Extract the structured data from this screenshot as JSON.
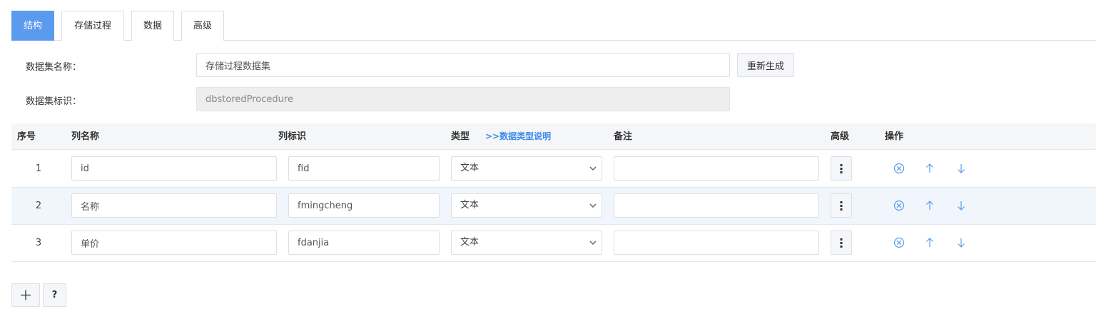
{
  "tabs": [
    {
      "label": "结构",
      "active": true
    },
    {
      "label": "存储过程",
      "active": false
    },
    {
      "label": "数据",
      "active": false
    },
    {
      "label": "高级",
      "active": false
    }
  ],
  "form": {
    "name_label": "数据集名称：",
    "name_value": "存储过程数据集",
    "regenerate_label": "重新生成",
    "id_label": "数据集标识：",
    "id_value": "dbstoredProcedure"
  },
  "table": {
    "headers": {
      "index": "序号",
      "column_name": "列名称",
      "column_id": "列标识",
      "type": "类型",
      "type_help": ">>数据类型说明",
      "remark": "备注",
      "advanced": "高级",
      "actions": "操作"
    },
    "rows": [
      {
        "index": "1",
        "name": "id",
        "id": "fid",
        "type": "文本",
        "remark": ""
      },
      {
        "index": "2",
        "name": "名称",
        "id": "fmingcheng",
        "type": "文本",
        "remark": ""
      },
      {
        "index": "3",
        "name": "单价",
        "id": "fdanjia",
        "type": "文本",
        "remark": ""
      }
    ]
  },
  "footer": {
    "help_label": "?"
  },
  "icons": {
    "add": "plus-icon",
    "remove": "circle-x-icon",
    "up": "arrow-up-icon",
    "down": "arrow-down-icon",
    "more": "vertical-dots-icon",
    "dropdown": "chevron-down-icon"
  },
  "colors": {
    "accent": "#5b9bef",
    "link": "#3e8be8",
    "icon": "#5b9bef"
  }
}
